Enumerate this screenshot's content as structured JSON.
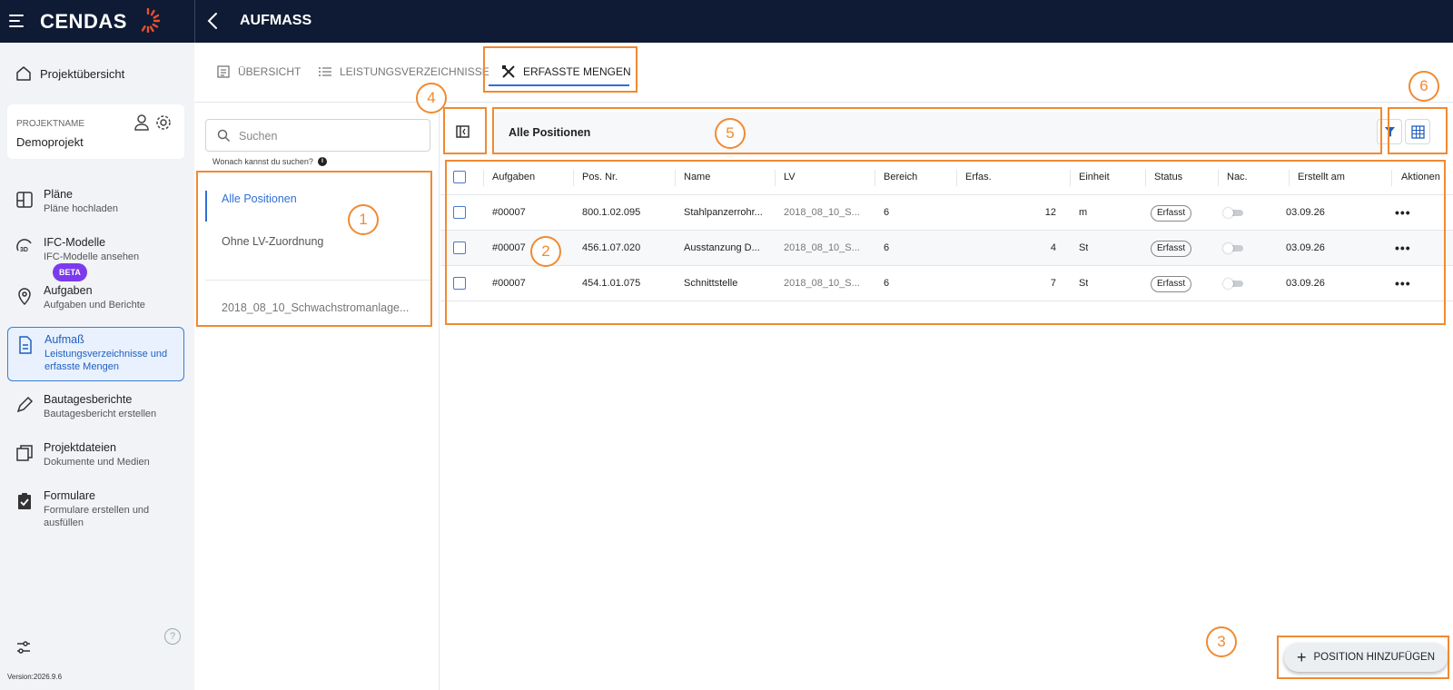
{
  "header": {
    "logo": "CENDAS",
    "title": "AUFMASS"
  },
  "sidebar": {
    "home_label": "Projektübersicht",
    "project": {
      "label": "PROJEKTNAME",
      "name": "Demoprojekt"
    },
    "items": [
      {
        "title": "Pläne",
        "sub": "Pläne hochladen",
        "icon": "plans-icon"
      },
      {
        "title": "IFC-Modelle",
        "sub": "IFC-Modelle ansehen",
        "icon": "3d-icon",
        "badge": "BETA"
      },
      {
        "title": "Aufgaben",
        "sub": "Aufgaben und Berichte",
        "icon": "pin-icon"
      },
      {
        "title": "Aufmaß",
        "sub": "Leistungsverzeichnisse und erfasste Mengen",
        "icon": "document-icon",
        "active": true
      },
      {
        "title": "Bautagesberichte",
        "sub": "Bautagesbericht erstellen",
        "icon": "pencil-icon"
      },
      {
        "title": "Projektdateien",
        "sub": "Dokumente und Medien",
        "icon": "files-icon"
      },
      {
        "title": "Formulare",
        "sub": "Formulare erstellen und ausfüllen",
        "icon": "clipboard-icon"
      }
    ],
    "help": "?",
    "version": "Version:2026.9.6"
  },
  "tabs": [
    {
      "label": "ÜBERSICHT",
      "icon": "overview-icon"
    },
    {
      "label": "LEISTUNGSVERZEICHNISSE",
      "icon": "list-icon"
    },
    {
      "label": "ERFASSTE MENGEN",
      "icon": "tools-icon",
      "active": true
    }
  ],
  "leftpanel": {
    "search_placeholder": "Suchen",
    "hint": "Wonach kannst du suchen?",
    "items": [
      "Alle Positionen",
      "Ohne LV-Zuordnung",
      "2018_08_10_Schwachstromanlage..."
    ]
  },
  "breadcrumb": "Alle Positionen",
  "table": {
    "headers": [
      "Aufgaben",
      "Pos. Nr.",
      "Name",
      "LV",
      "Bereich",
      "Erfas.",
      "Einheit",
      "Status",
      "Nac.",
      "Erstellt am",
      "Aktionen"
    ],
    "rows": [
      {
        "aufgaben": "#00007",
        "pos": "800.1.02.095",
        "name": "Stahlpanzerrohr...",
        "lv": "2018_08_10_S...",
        "bereich": "6",
        "erfas": "12",
        "einheit": "m",
        "status": "Erfasst",
        "erstellt": "03.09.26",
        "aktionen": "•••"
      },
      {
        "aufgaben": "#00007",
        "pos": "456.1.07.020",
        "name": "Ausstanzung D...",
        "lv": "2018_08_10_S...",
        "bereich": "6",
        "erfas": "4",
        "einheit": "St",
        "status": "Erfasst",
        "erstellt": "03.09.26",
        "aktionen": "•••"
      },
      {
        "aufgaben": "#00007",
        "pos": "454.1.01.075",
        "name": "Schnittstelle",
        "lv": "2018_08_10_S...",
        "bereich": "6",
        "erfas": "7",
        "einheit": "St",
        "status": "Erfasst",
        "erstellt": "03.09.26",
        "aktionen": "•••"
      }
    ]
  },
  "add_button": "POSITION HINZUFÜGEN",
  "annotations": [
    "1",
    "2",
    "3",
    "4",
    "5",
    "6"
  ],
  "colors": {
    "topbar": "#0f1b35",
    "accent": "#2f6fd6",
    "annotation": "#f08a32",
    "beta": "#7c3aed"
  }
}
